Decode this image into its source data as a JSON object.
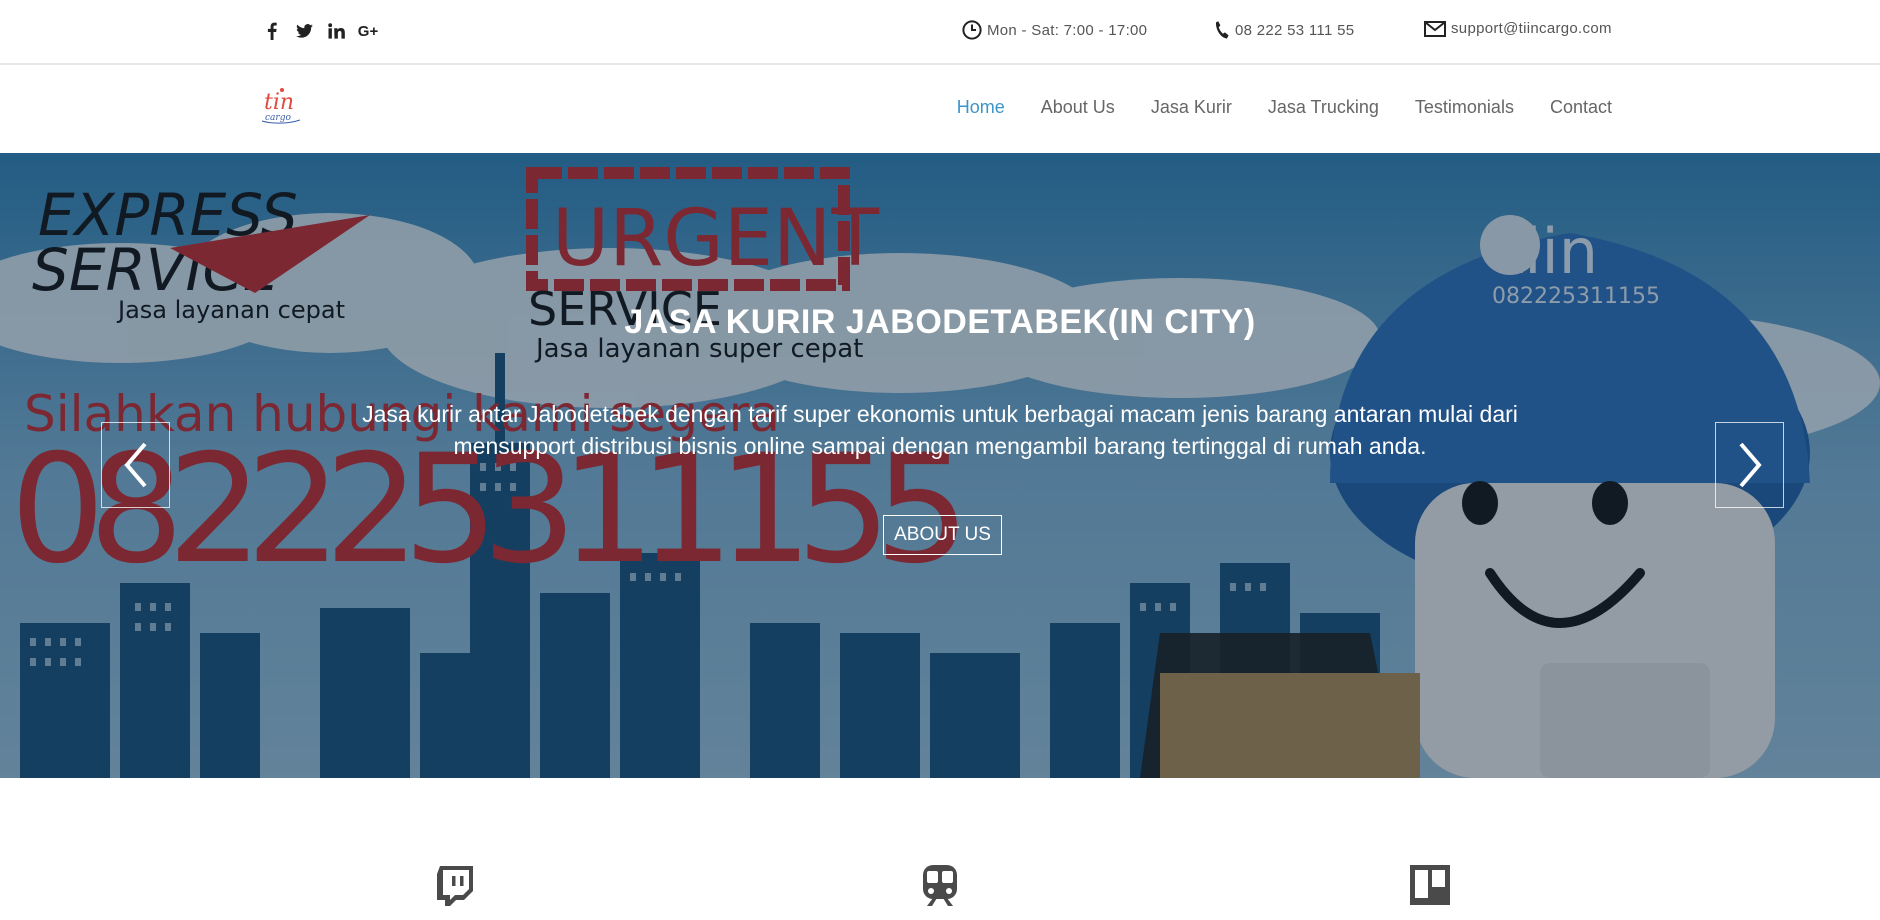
{
  "topbar": {
    "social": [
      {
        "icon": "facebook-icon",
        "glyph": "f"
      },
      {
        "icon": "twitter-icon",
        "glyph": ""
      },
      {
        "icon": "linkedin-icon",
        "glyph": "in"
      },
      {
        "icon": "google-plus-icon",
        "glyph": "G+"
      }
    ],
    "hours": "Mon - Sat: 7:00 - 17:00",
    "phone": "08 222 53 111 55",
    "email": "support@tiincargo.com"
  },
  "navbar": {
    "logo_text": "tiin cargo",
    "items": [
      {
        "label": "Home",
        "active": true
      },
      {
        "label": "About Us",
        "active": false
      },
      {
        "label": "Jasa Kurir",
        "active": false
      },
      {
        "label": "Jasa Trucking",
        "active": false
      },
      {
        "label": "Testimonials",
        "active": false
      },
      {
        "label": "Contact",
        "active": false
      }
    ]
  },
  "hero": {
    "title": "JASA KURIR JABODETABEK(IN CITY)",
    "description": "Jasa kurir antar Jabodetabek dengan tarif super ekonomis untuk berbagai macam jenis barang antaran mulai dari mensupport distribusi bisnis online sampai dengan mengambil barang tertinggal di rumah anda.",
    "button_label": "ABOUT US",
    "bg_text": {
      "express": "EXPRESS",
      "service1": "SERVICE",
      "sub1": "Jasa layanan cepat",
      "urgent": "URGENT",
      "service2": "SERVICE",
      "sub2": "Jasa layanan  super cepat",
      "call": "Silahkan hubungi kami segera",
      "number": "082225311155",
      "cap_brand": "tiin",
      "cap_number": "082225311155"
    }
  },
  "features": [
    {
      "icon": "twitch-icon"
    },
    {
      "icon": "train-icon"
    },
    {
      "icon": "trello-icon"
    }
  ],
  "colors": {
    "accent": "#3c95c9",
    "nav_text": "#666666",
    "hero_red": "#c8282d"
  }
}
